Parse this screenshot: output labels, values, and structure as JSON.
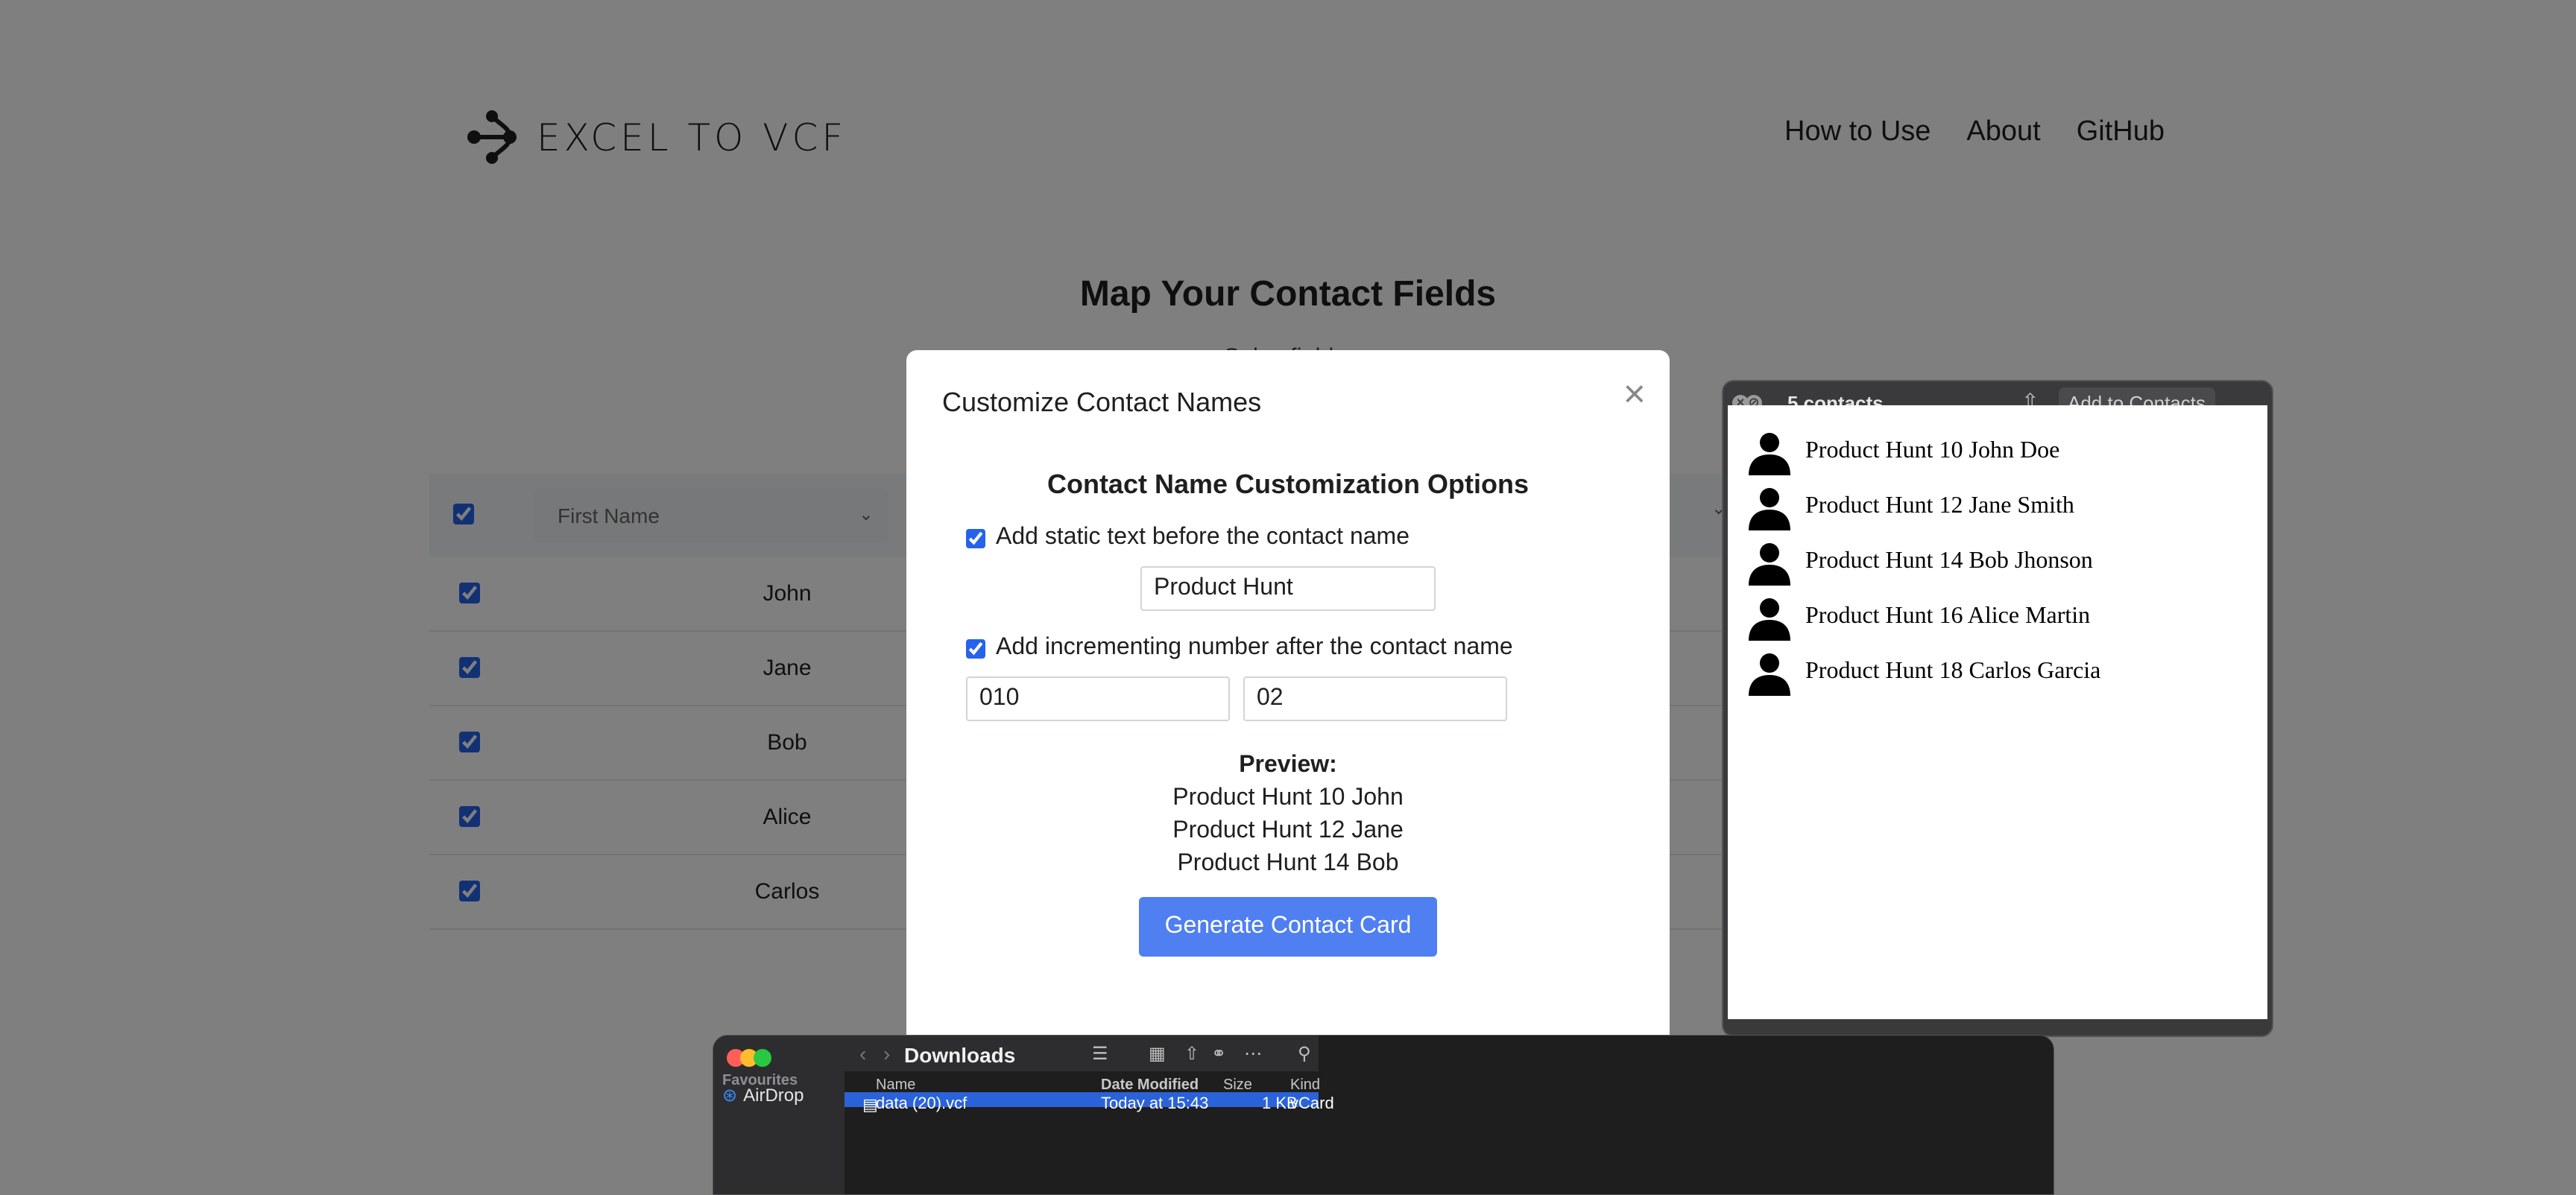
{
  "site": {
    "logo_text": "EXCEL TO VCF",
    "nav": [
      "How to Use",
      "About",
      "GitHub"
    ],
    "title": "Map Your Contact Fields",
    "subtitle": "Selec fields."
  },
  "table": {
    "column_select": "First Name",
    "rows": [
      "John",
      "Jane",
      "Bob",
      "Alice",
      "Carlos"
    ]
  },
  "modal": {
    "title": "Customize Contact Names",
    "heading": "Contact Name Customization Options",
    "static_label": "Add static text before the contact name",
    "static_value": "Product Hunt",
    "increment_label": "Add incrementing number after the contact name",
    "start_value": "010",
    "step_value": "02",
    "preview_heading": "Preview:",
    "preview": [
      "Product Hunt 10 John",
      "Product Hunt 12 Jane",
      "Product Hunt 14 Bob"
    ],
    "generate_label": "Generate Contact Card"
  },
  "quicklook": {
    "count": "5 contacts",
    "add_label": "Add to Contacts",
    "contacts": [
      "Product Hunt 10 John Doe",
      "Product Hunt 12 Jane Smith",
      "Product Hunt 14 Bob Jhonson",
      "Product Hunt 16 Alice Martin",
      "Product Hunt 18 Carlos Garcia"
    ]
  },
  "finder": {
    "title": "Downloads",
    "sidebar_heading": "Favourites",
    "sidebar_item": "AirDrop",
    "columns": [
      "Name",
      "Date Modified",
      "Size",
      "Kind"
    ],
    "file": {
      "name": "data (20).vcf",
      "date": "Today at 15:43",
      "size": "1 KB",
      "kind": "vCard"
    }
  },
  "colors": {
    "accent": "#2563eb",
    "button": "#4f7ff0",
    "selection": "#2a62d9"
  }
}
